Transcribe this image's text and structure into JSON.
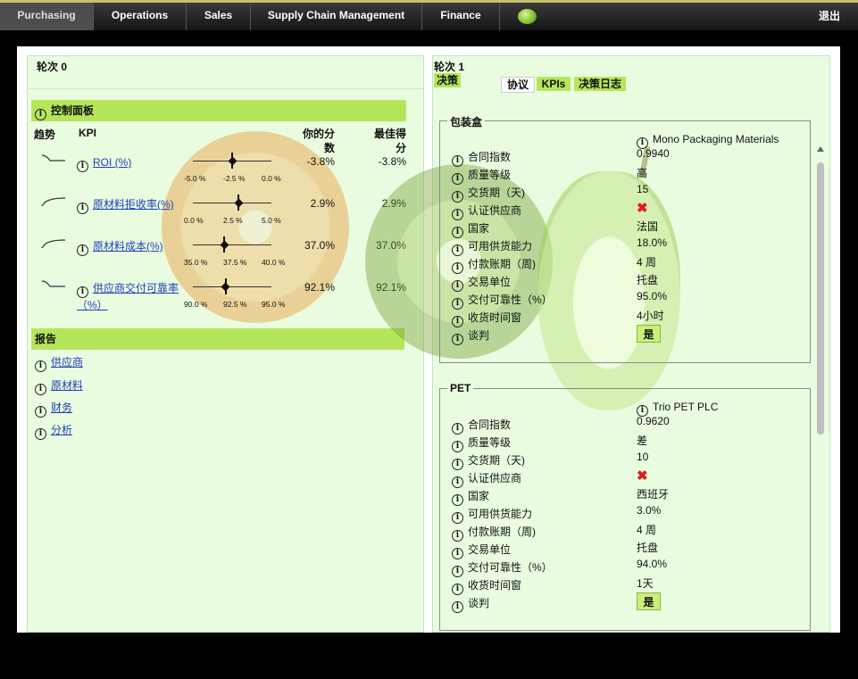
{
  "nav": {
    "tabs": [
      {
        "label": "Purchasing",
        "active": true
      },
      {
        "label": "Operations"
      },
      {
        "label": "Sales"
      },
      {
        "label": "Supply Chain Management"
      },
      {
        "label": "Finance"
      }
    ],
    "exit_label": "退出"
  },
  "left": {
    "round_title": "轮次 0",
    "dashboard_title": "控制面板",
    "headers": {
      "trend": "趋势",
      "kpi": "KPI",
      "your_score": "你的分数",
      "best_score": "最佳得分"
    },
    "kpis": [
      {
        "name": "ROI (%)",
        "trend": "down",
        "ticks": [
          "-5.0 %",
          "-2.5 %",
          "0.0 %"
        ],
        "marker_fraction": 0.5,
        "your": "-3.8%",
        "best": "-3.8%"
      },
      {
        "name": "原材料拒收率(%)",
        "trend": "up",
        "ticks": [
          "0.0 %",
          "2.5 %",
          "5.0 %"
        ],
        "marker_fraction": 0.58,
        "your": "2.9%",
        "best": "2.9%"
      },
      {
        "name": "原材料成本(%)",
        "trend": "up",
        "ticks": [
          "35.0 %",
          "37.5 %",
          "40.0 %"
        ],
        "marker_fraction": 0.4,
        "your": "37.0%",
        "best": "37.0%"
      },
      {
        "name": "供应商交付可靠率（%）",
        "trend": "down",
        "ticks": [
          "90.0 %",
          "92.5 %",
          "95.0 %"
        ],
        "marker_fraction": 0.42,
        "your": "92.1%",
        "best": "92.1%"
      }
    ],
    "reports_title": "报告",
    "reports": [
      "供应商",
      "原材料",
      "财务",
      "分析"
    ]
  },
  "right": {
    "round_title": "轮次 1",
    "decision_label": "决策",
    "tabs": [
      "协议",
      "KPIs",
      "决策日志"
    ],
    "field_labels": [
      "合同指数",
      "质量等级",
      "交货期（天)",
      "认证供应商",
      "国家",
      "可用供货能力",
      "付款账期（周)",
      "交易单位",
      "交付可靠性（%）",
      "收货时间窗",
      "谈判"
    ],
    "groups": [
      {
        "legend": "包装盒",
        "supplier": "Mono Packaging Materials",
        "values": [
          "0.9940",
          "高",
          "15",
          "",
          "法国",
          "18.0%",
          "4 周",
          "托盘",
          "95.0%",
          "4小时"
        ],
        "negotiate_label": "是"
      },
      {
        "legend": "PET",
        "supplier": "Trio PET PLC",
        "values": [
          "0.9620",
          "差",
          "10",
          "",
          "西班牙",
          "3.0%",
          "4 周",
          "托盘",
          "94.0%",
          "1天"
        ],
        "negotiate_label": "是"
      }
    ],
    "certified_icon": "red-x-icon"
  },
  "colors": {
    "accent_green": "#b5e65a",
    "panel_bg": "#eafce0",
    "link": "#1d3fb8"
  }
}
